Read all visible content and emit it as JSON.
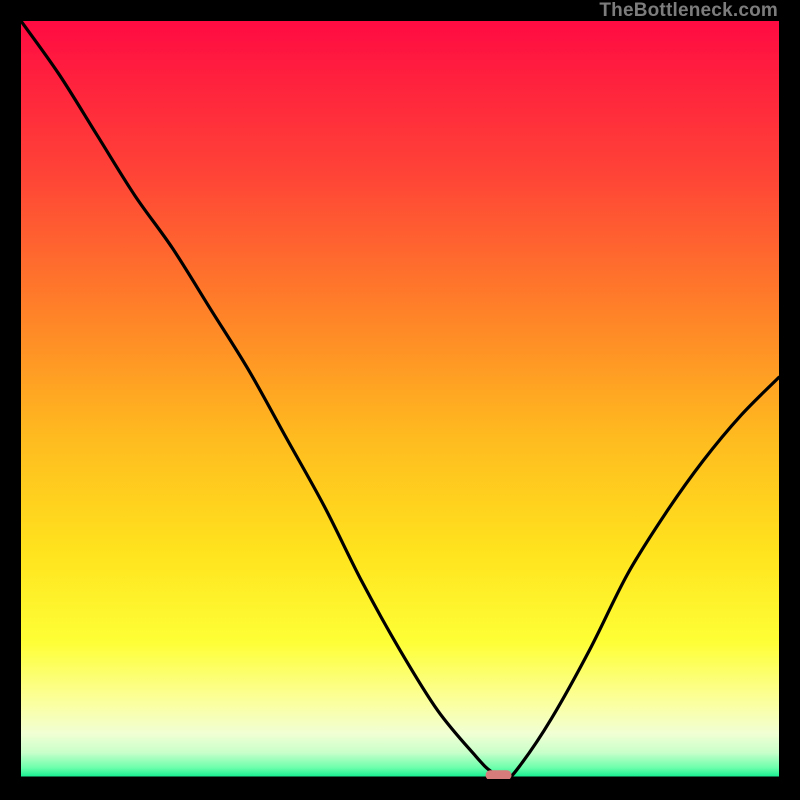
{
  "attribution": "TheBottleneck.com",
  "chart_data": {
    "type": "line",
    "title": "",
    "xlabel": "",
    "ylabel": "",
    "xlim": [
      0,
      100
    ],
    "ylim": [
      0,
      100
    ],
    "series": [
      {
        "name": "bottleneck-curve",
        "x": [
          0,
          5,
          10,
          15,
          20,
          25,
          30,
          35,
          40,
          45,
          50,
          55,
          60,
          62,
          64,
          66,
          70,
          75,
          80,
          85,
          90,
          95,
          100
        ],
        "y": [
          100,
          93,
          85,
          77,
          70,
          62,
          54,
          45,
          36,
          26,
          17,
          9,
          3,
          1,
          0,
          2,
          8,
          17,
          27,
          35,
          42,
          48,
          53
        ]
      }
    ],
    "marker": {
      "x": 63,
      "y": 0.5,
      "color": "#d77b7b"
    },
    "background_gradient": {
      "stops": [
        {
          "offset": 0,
          "color": "#ff0b42"
        },
        {
          "offset": 0.2,
          "color": "#ff4337"
        },
        {
          "offset": 0.4,
          "color": "#ff8727"
        },
        {
          "offset": 0.55,
          "color": "#ffbb1f"
        },
        {
          "offset": 0.7,
          "color": "#ffe31e"
        },
        {
          "offset": 0.82,
          "color": "#feff36"
        },
        {
          "offset": 0.9,
          "color": "#fbffa0"
        },
        {
          "offset": 0.94,
          "color": "#f1ffd4"
        },
        {
          "offset": 0.965,
          "color": "#c9ffca"
        },
        {
          "offset": 0.985,
          "color": "#6dffac"
        },
        {
          "offset": 1.0,
          "color": "#00e989"
        }
      ]
    }
  }
}
